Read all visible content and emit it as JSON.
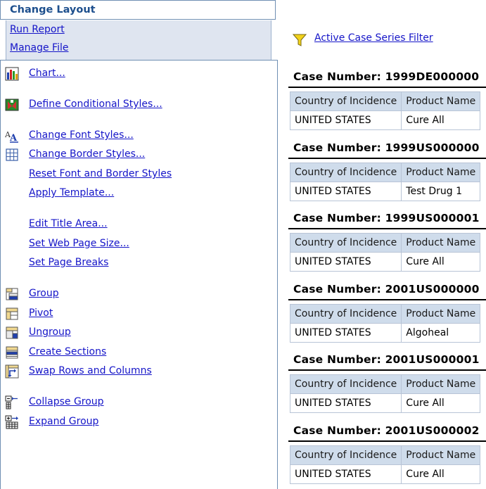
{
  "panel": {
    "title": "Change Layout",
    "top_links": [
      "Run Report",
      "Manage File"
    ],
    "menu": [
      {
        "label": "Chart...",
        "icon": "bar-chart-icon"
      },
      {
        "label": "Define Conditional Styles...",
        "icon": "conditional-styles-icon"
      },
      {
        "label": "Change Font Styles...",
        "icon": "font-styles-icon"
      },
      {
        "label": "Change Border Styles...",
        "icon": "border-grid-icon"
      },
      {
        "label": "Reset Font and Border Styles",
        "icon": ""
      },
      {
        "label": "Apply Template...",
        "icon": ""
      },
      {
        "label": "Edit Title Area...",
        "icon": ""
      },
      {
        "label": "Set Web Page Size...",
        "icon": ""
      },
      {
        "label": "Set Page Breaks",
        "icon": ""
      },
      {
        "label": "Group",
        "icon": "group-icon"
      },
      {
        "label": "Pivot",
        "icon": "pivot-icon"
      },
      {
        "label": "Ungroup",
        "icon": "ungroup-icon"
      },
      {
        "label": "Create Sections",
        "icon": "sections-icon"
      },
      {
        "label": "Swap Rows and Columns",
        "icon": "swap-icon"
      },
      {
        "label": "Collapse Group",
        "icon": "collapse-group-icon"
      },
      {
        "label": "Expand Group",
        "icon": "expand-group-icon"
      }
    ]
  },
  "filter": {
    "label": "Active Case Series Filter",
    "icon": "funnel-filter-icon"
  },
  "columns": [
    "Country of Incidence",
    "Product Name"
  ],
  "cases": [
    {
      "title": "Case Number: 1999DE000000",
      "country": "UNITED STATES",
      "product": "Cure All"
    },
    {
      "title": "Case Number: 1999US000000",
      "country": "UNITED STATES",
      "product": "Test Drug 1"
    },
    {
      "title": "Case Number: 1999US000001",
      "country": "UNITED STATES",
      "product": "Cure All"
    },
    {
      "title": "Case Number: 2001US000000",
      "country": "UNITED STATES",
      "product": "Algoheal"
    },
    {
      "title": "Case Number: 2001US000001",
      "country": "UNITED STATES",
      "product": "Cure All"
    },
    {
      "title": "Case Number: 2001US000002",
      "country": "UNITED STATES",
      "product": "Cure All"
    }
  ],
  "colors": {
    "accent": "#1d4f8d",
    "link": "#1515c8",
    "header_bg": "#cfdceb",
    "panel_bg": "#dfe5f0"
  }
}
